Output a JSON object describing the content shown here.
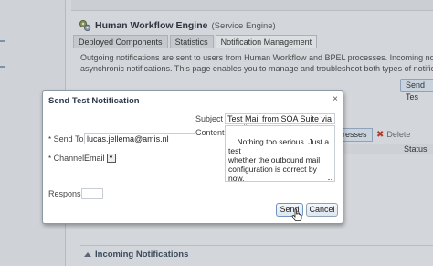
{
  "background": {
    "engine_title": "Human Workflow Engine",
    "engine_subtitle": "(Service Engine)",
    "tabs": [
      {
        "label": "Deployed Components",
        "active": false
      },
      {
        "label": "Statistics",
        "active": false
      },
      {
        "label": "Notification Management",
        "active": true
      }
    ],
    "description_line1": "Outgoing notifications are sent to users from Human Workflow and BPEL processes. Incoming notifications are resp",
    "description_line2": "asynchronic notifications. This page enables you to manage and troubleshoot both types of notifications.",
    "send_test_button": "Send Tes",
    "addresses_button": "resses",
    "delete_button": "Delete",
    "status_header": "Status",
    "incoming_section": "Incoming Notifications"
  },
  "dialog": {
    "title": "Send Test Notification",
    "close_glyph": "×",
    "send_to_label": "Send To",
    "send_to_value": "lucas.jellema@amis.nl",
    "channel_label": "Channel",
    "channel_value": "Email",
    "response_label": "Response",
    "response_value": "",
    "subject_label": "Subject",
    "subject_value": "Test Mail from SOA Suite via gmail",
    "content_label": "Content",
    "content_value": "Nothing too serious. Just a test\nwhether the outbound mail\nconfiguration is correct by now.\nAt last. Finally!\n\nthanks, Lucas",
    "required_marker": "*",
    "send_button": "Send",
    "cancel_button": "Cancel"
  }
}
